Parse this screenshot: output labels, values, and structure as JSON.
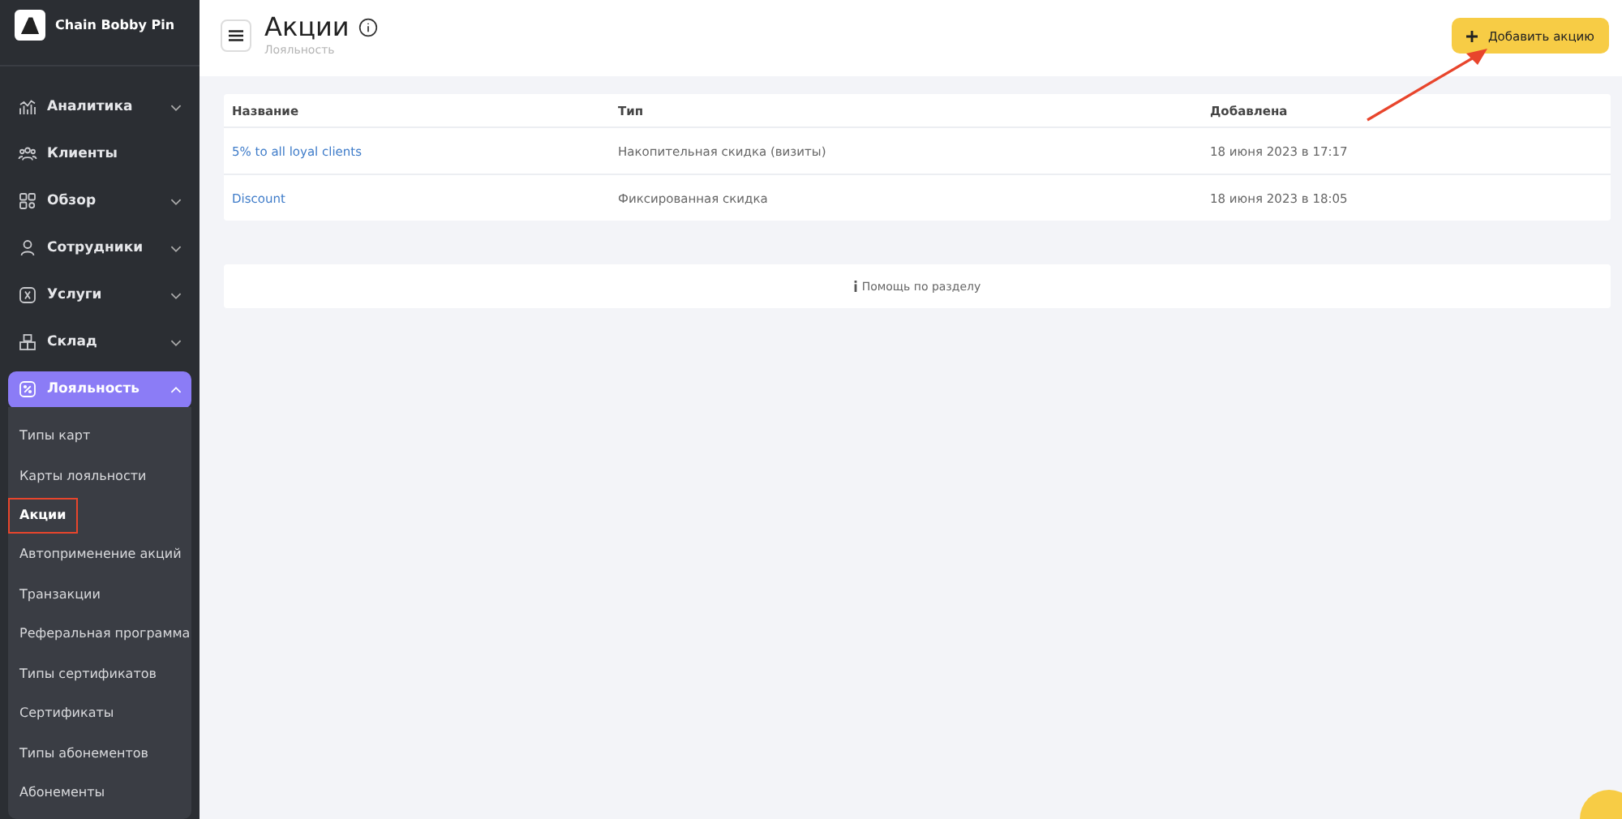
{
  "sidebar": {
    "brand": "Chain Bobby Pin",
    "items": [
      {
        "label": "Аналитика",
        "kind": "group",
        "expanded": false,
        "selected": false
      },
      {
        "label": "Клиенты",
        "kind": "link",
        "selected": false
      },
      {
        "label": "Обзор",
        "kind": "group",
        "expanded": false,
        "selected": false
      },
      {
        "label": "Сотрудники",
        "kind": "group",
        "expanded": false,
        "selected": false
      },
      {
        "label": "Услуги",
        "kind": "group",
        "expanded": false,
        "selected": false
      },
      {
        "label": "Склад",
        "kind": "group",
        "expanded": false,
        "selected": false
      },
      {
        "label": "Лояльность",
        "kind": "group",
        "expanded": true,
        "selected": true,
        "children": [
          {
            "label": "Типы карт",
            "selected": false,
            "highlighted": false
          },
          {
            "label": "Карты лояльности",
            "selected": false,
            "highlighted": false
          },
          {
            "label": "Акции",
            "selected": true,
            "highlighted": true
          },
          {
            "label": "Автоприменение акций",
            "selected": false,
            "highlighted": false
          },
          {
            "label": "Транзакции",
            "selected": false,
            "highlighted": false
          },
          {
            "label": "Реферальная программа",
            "selected": false,
            "highlighted": false
          },
          {
            "label": "Типы сертификатов",
            "selected": false,
            "highlighted": false
          },
          {
            "label": "Сертификаты",
            "selected": false,
            "highlighted": false
          },
          {
            "label": "Типы абонементов",
            "selected": false,
            "highlighted": false
          },
          {
            "label": "Абонементы",
            "selected": false,
            "highlighted": false
          }
        ]
      }
    ]
  },
  "header": {
    "title": "Акции",
    "breadcrumb": "Лояльность",
    "add_button": "Добавить акцию"
  },
  "table": {
    "columns": [
      "Название",
      "Тип",
      "Добавлена"
    ],
    "rows": [
      [
        "5% to all loyal clients",
        "Накопительная скидка (визиты)",
        "18 июня 2023 в 17:17"
      ],
      [
        "Discount",
        "Фиксированная скидка",
        "18 июня 2023 в 18:05"
      ]
    ]
  },
  "help": "Помощь по разделу"
}
